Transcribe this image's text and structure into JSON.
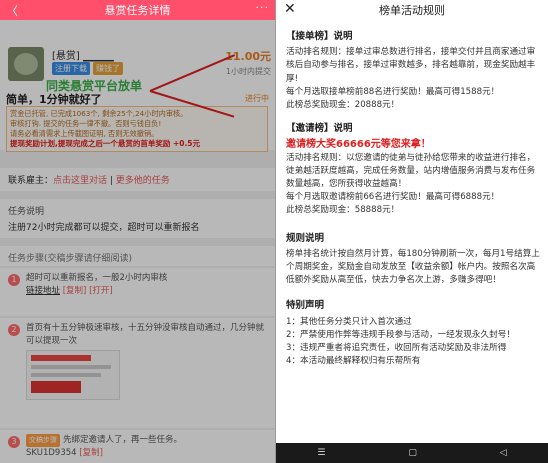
{
  "left": {
    "title": "悬赏任务详情",
    "back": "〈",
    "more": "···",
    "username": "[悬赏] ▁▁▁▁",
    "tags": [
      "注册下载",
      "赚钱了"
    ],
    "price": "11.00元",
    "time_limit": "1小时内提交",
    "promo": "同类悬赏平台放单",
    "task_title": "简单，1分钟就好了",
    "status": "进行中",
    "notice_lines": [
      "赏金已托管, 已完成1063个, 剩余25个,24小时内审核。",
      "审核打钩. 提交的任务一律不撤。否则亏钱自负!",
      "请务必看清需求上传截图证明, 否则无效撤销。"
    ],
    "notice_red": "提现奖励计划,提现完成之后一个悬赏的首单奖励 +0.5元",
    "employer_label": "联系雇主：",
    "employer_link1": "点击这里对话",
    "employer_link2": "更多他的任务",
    "desc_title": "任务说明",
    "desc_text": "注册72小时完成都可以提交，超时可以重新报名",
    "steps_title": "任务步骤(交稿步骤请仔细阅读)",
    "step1_text": "超时可以重新报名，一般2小时内审核",
    "step1_link": "链接地址",
    "step1_copy": "[复制]",
    "step1_open": "[打开]",
    "step2_text": "首页有十五分钟极速审核，十五分钟没审核自动通过，几分钟就可以提现一次",
    "step3_badge": "交稿步骤",
    "step3_text": "先绑定邀请人了，再一些任务。",
    "step3_code": "SKU1D9354",
    "step3_copy": "[复制]"
  },
  "right": {
    "title": "榜单活动规则",
    "close": "✕",
    "s1_title": "【接单榜】说明",
    "s1_body": "活动排名规则：接单过审总数进行排名，接单交付并且商家通过审核后自动参与排名，接单过审数越多，排名越靠前，现金奖励越丰厚!",
    "s1_award": "每个月选取接单榜前88名进行奖励！最高可得1588元！",
    "s1_total": "此榜总奖励现金：20888元！",
    "s2_title": "【邀请榜】说明",
    "s2_headline": "邀请榜大奖66666元等您来拿！",
    "s2_body": "活动排名规则：以您邀请的徒弟与徒孙给您带来的收益进行排名，徒弟越活跃度越高，完成任务数量，站内增值服务消费与发布任务数量越高，您所获得收益越高！",
    "s2_award": "每个月选取邀请榜前66名进行奖励！最高可得6888元！",
    "s2_total": "此榜总奖励现金：58888元！",
    "s3_title": "规则说明",
    "s3_body": "榜单排名统计按自然月计算，每180分钟刷新一次，每月1号结算上个周期奖金，奖励金自动发放至【收益余额】帐户内。按照名次高低额外奖励从高至低，快去力争名次上游，多赚多得吧！",
    "s4_title": "特别声明",
    "s4_items": [
      "1：其他任务分类只计入首次通过",
      "2：严禁使用作弊等违规手段参与活动，一经发现永久封号！",
      "3：违规严重者将追究责任，收回所有活动奖励及非法所得",
      "4：本活动最终解释权归有乐帮所有"
    ],
    "nav": [
      "☰",
      "▢",
      "◁"
    ]
  },
  "colors": {
    "accent": "#ff4f6a",
    "red": "#e02020",
    "green": "#3bb04a",
    "orange": "#e67e22"
  }
}
